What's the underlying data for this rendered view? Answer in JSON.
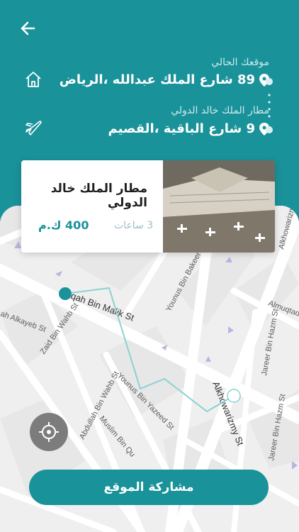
{
  "header": {
    "current_location_label": "موقعك الحالي",
    "current_location_address": "89 شارع الملك عبدالله ،الرياض",
    "destination_label": "مطار الملك خالد الدولي",
    "destination_address": "9 شارع الباقية ،القصيم"
  },
  "card": {
    "title": "مطار الملك خالد الدولي",
    "time": "3 ساعات",
    "distance": "400 ك.م"
  },
  "map": {
    "streets": [
      "Alkhowarizmy St",
      "Saqah Bin Malik St",
      "Younus Bin Bakeer St",
      "Almuqtadi",
      "Alkhowarizmy St",
      "Jareer Bin Hazm St",
      "Jareer Bin Hazm St",
      "Abdullah Bin Wahb St",
      "Younus Bin Yazeed St",
      "Muslim Bin Qu",
      "Zaid Bin Wahb St",
      "ah Alkayeb St"
    ]
  },
  "actions": {
    "share_label": "مشاركة الموقع"
  },
  "colors": {
    "primary": "#1a929a",
    "button": "#1a929a"
  },
  "icons": [
    "back-arrow-icon",
    "home-icon",
    "plane-icon",
    "location-pin-icon",
    "crosshair-icon"
  ]
}
